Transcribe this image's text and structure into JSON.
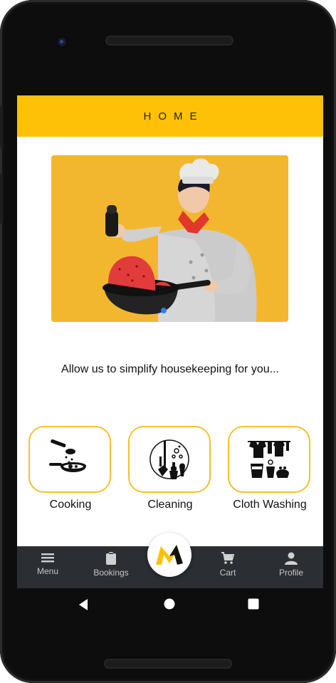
{
  "app_bar": {
    "title": "HOME"
  },
  "hero": {
    "illustration": "chef-cooking-illustration"
  },
  "tagline": "Allow us to simplify housekeeping for you...",
  "services": [
    {
      "label": "Cooking",
      "icon": "cooking-pan-icon"
    },
    {
      "label": "Cleaning",
      "icon": "cleaning-tools-icon"
    },
    {
      "label": "Cloth Washing",
      "icon": "laundry-icon"
    }
  ],
  "bottom_nav": {
    "items": [
      {
        "label": "Menu",
        "icon": "menu-icon"
      },
      {
        "label": "Bookings",
        "icon": "clipboard-icon"
      },
      {
        "label": "Cart",
        "icon": "cart-icon"
      },
      {
        "label": "Profile",
        "icon": "profile-icon"
      }
    ],
    "fab": {
      "icon": "app-logo-icon",
      "logo_text": "M"
    }
  },
  "colors": {
    "accent": "#FFC107",
    "hero_bg": "#F3B72F",
    "card_border": "#F5C02E",
    "nav_bg": "#2b2e33"
  }
}
